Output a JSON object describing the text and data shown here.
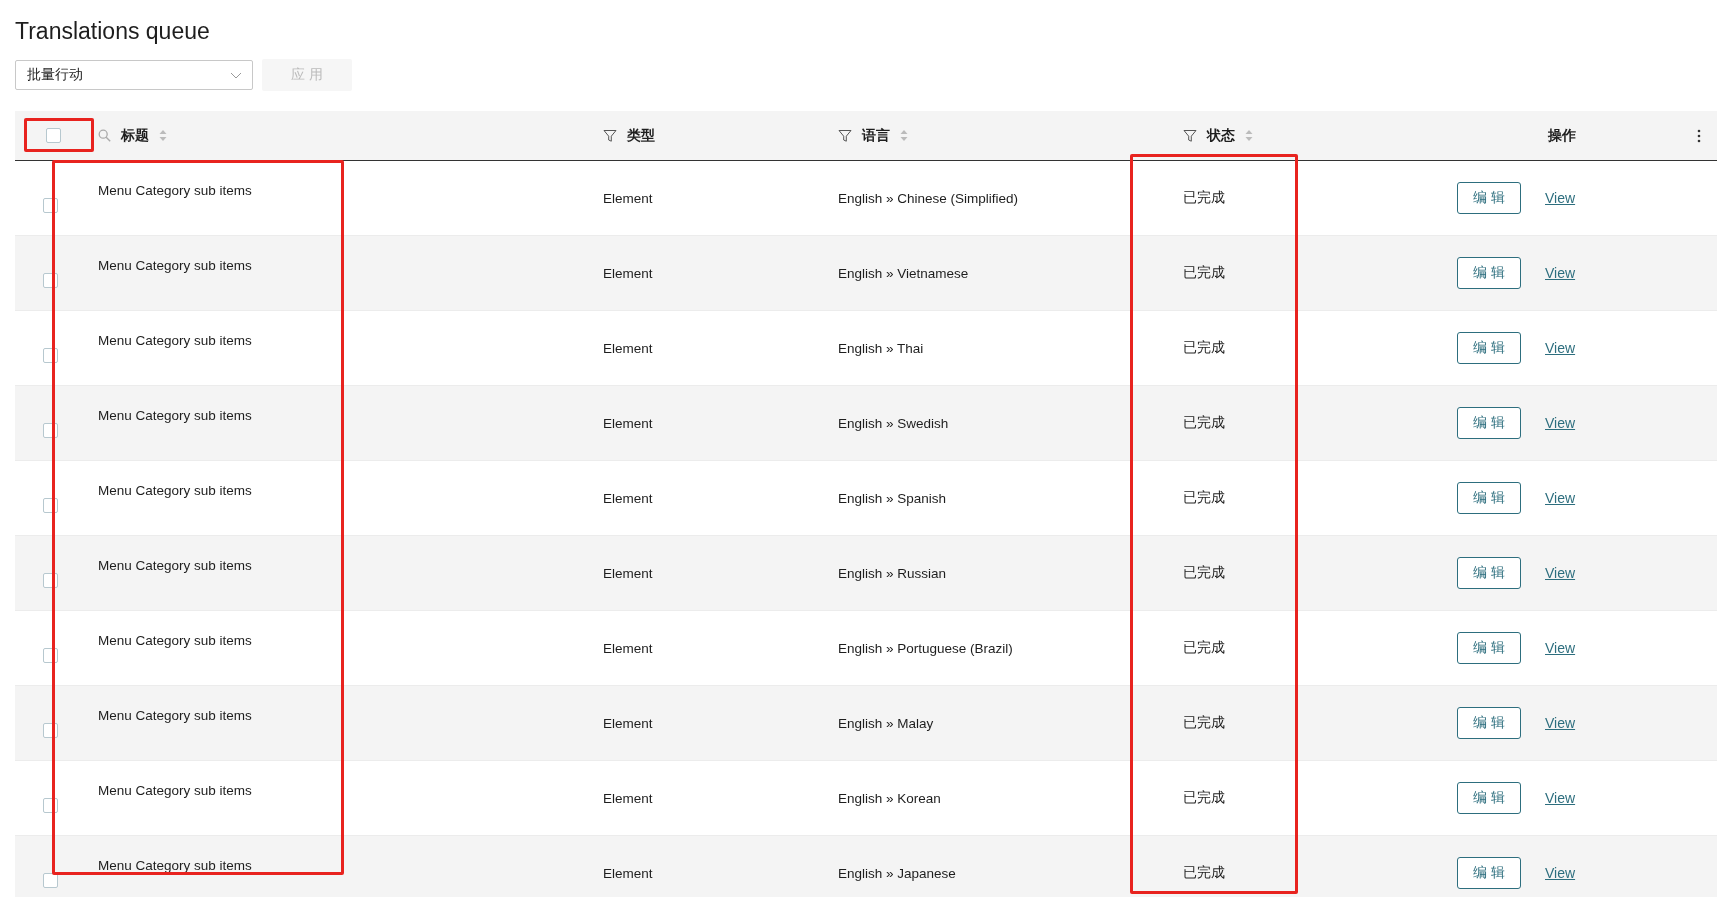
{
  "page": {
    "title": "Translations queue"
  },
  "bulk_actions": {
    "value": "批量行动"
  },
  "apply_button": {
    "label": "应 用",
    "disabled": true
  },
  "table": {
    "select_all": {
      "checked": false,
      "highlighted": true
    },
    "columns": [
      {
        "label": "标题",
        "kind": "search",
        "sortable": true,
        "highlighted": true
      },
      {
        "label": "类型",
        "kind": "filter",
        "sortable": false,
        "highlighted": false
      },
      {
        "label": "语言",
        "kind": "filter",
        "sortable": true,
        "highlighted": false
      },
      {
        "label": "状态",
        "kind": "filter",
        "sortable": true,
        "highlighted": true
      },
      {
        "label": "操作",
        "kind": "plain",
        "sortable": false,
        "highlighted": false
      }
    ],
    "rows": [
      {
        "checked": false,
        "title": "Menu Category sub items",
        "type": "Element",
        "language": "English » Chinese (Simplified)",
        "status": "已完成",
        "edit": "编 辑",
        "view": "View"
      },
      {
        "checked": false,
        "title": "Menu Category sub items",
        "type": "Element",
        "language": "English » Vietnamese",
        "status": "已完成",
        "edit": "编 辑",
        "view": "View"
      },
      {
        "checked": false,
        "title": "Menu Category sub items",
        "type": "Element",
        "language": "English » Thai",
        "status": "已完成",
        "edit": "编 辑",
        "view": "View"
      },
      {
        "checked": false,
        "title": "Menu Category sub items",
        "type": "Element",
        "language": "English » Swedish",
        "status": "已完成",
        "edit": "编 辑",
        "view": "View"
      },
      {
        "checked": false,
        "title": "Menu Category sub items",
        "type": "Element",
        "language": "English » Spanish",
        "status": "已完成",
        "edit": "编 辑",
        "view": "View"
      },
      {
        "checked": false,
        "title": "Menu Category sub items",
        "type": "Element",
        "language": "English » Russian",
        "status": "已完成",
        "edit": "编 辑",
        "view": "View"
      },
      {
        "checked": false,
        "title": "Menu Category sub items",
        "type": "Element",
        "language": "English » Portuguese (Brazil)",
        "status": "已完成",
        "edit": "编 辑",
        "view": "View"
      },
      {
        "checked": false,
        "title": "Menu Category sub items",
        "type": "Element",
        "language": "English » Malay",
        "status": "已完成",
        "edit": "编 辑",
        "view": "View"
      },
      {
        "checked": false,
        "title": "Menu Category sub items",
        "type": "Element",
        "language": "English » Korean",
        "status": "已完成",
        "edit": "编 辑",
        "view": "View"
      },
      {
        "checked": false,
        "title": "Menu Category sub items",
        "type": "Element",
        "language": "English » Japanese",
        "status": "已完成",
        "edit": "编 辑",
        "view": "View"
      }
    ]
  }
}
